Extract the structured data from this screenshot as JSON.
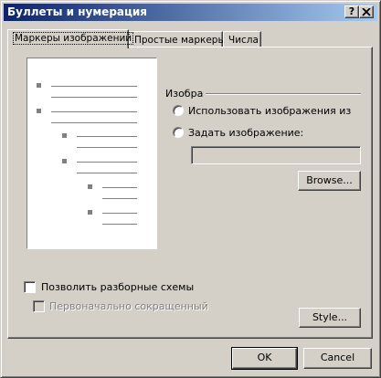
{
  "window": {
    "title": "Буллеты и нумерация",
    "help_button": "?",
    "close_button": "X"
  },
  "tabs": [
    {
      "label": "Маркеры изображений",
      "active": true
    },
    {
      "label": "Простые маркеры",
      "active": false
    },
    {
      "label": "Числа",
      "active": false
    }
  ],
  "image_group": {
    "label": "Изобра",
    "use_images_label": "Использовать изображения из тем",
    "set_image_label": "Задать изображение:",
    "image_path_value": "",
    "browse_button": "Browse..."
  },
  "options": {
    "allow_collapsible_label": "Позволить разборные схемы",
    "allow_collapsible_checked": false,
    "initially_collapsed_label": "Первоначально сокращенный",
    "initially_collapsed_checked": false,
    "initially_collapsed_enabled": false
  },
  "style_button": "Style...",
  "footer": {
    "ok_button": "OK",
    "cancel_button": "Cancel"
  },
  "colors": {
    "titlebar_start": "#0a246a",
    "titlebar_end": "#a6caf0",
    "face": "#d4d0c8"
  }
}
